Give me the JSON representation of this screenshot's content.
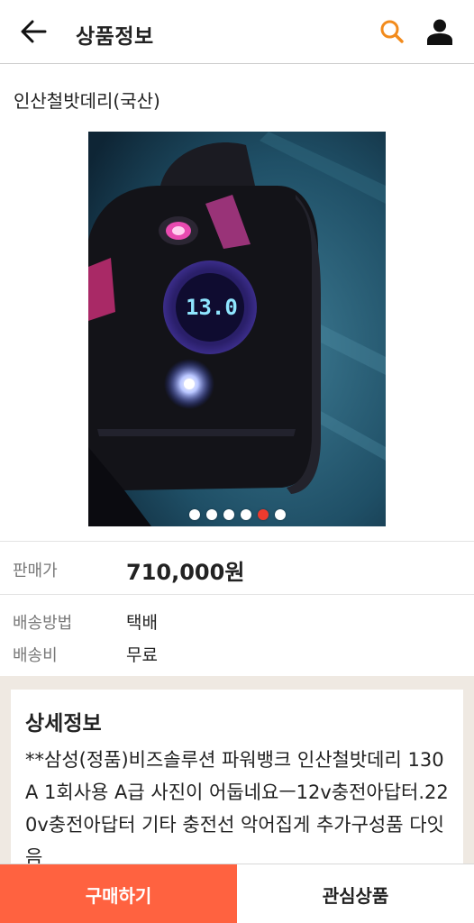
{
  "header": {
    "title": "상품정보",
    "back_icon": "arrow-left-icon",
    "search_icon": "search-icon",
    "user_icon": "user-icon",
    "search_color": "#f28b1c"
  },
  "product": {
    "name": "인산철밧데리(국산)",
    "gallery": {
      "image_count": 6,
      "active_index": 5,
      "display_reading": "13.0",
      "prev_icon": "chevron-left-icon",
      "next_icon": "chevron-right-icon"
    },
    "price_label": "판매가",
    "price_value": "710,000원",
    "shipping_method_label": "배송방법",
    "shipping_method_value": "택배",
    "shipping_fee_label": "배송비",
    "shipping_fee_value": "무료"
  },
  "detail": {
    "title": "상세정보",
    "body": "**삼성(정품)비즈솔루션 파워뱅크 인산철밧데리 130A 1회사용 A급 사진이 어둡네요ㅡ12v충전아답터.220v충전아답터 기타 충전선 악어집게 추가구성품 다잇음"
  },
  "actions": {
    "buy_label": "구매하기",
    "wishlist_label": "관심상품",
    "buy_color": "#ff6240"
  }
}
